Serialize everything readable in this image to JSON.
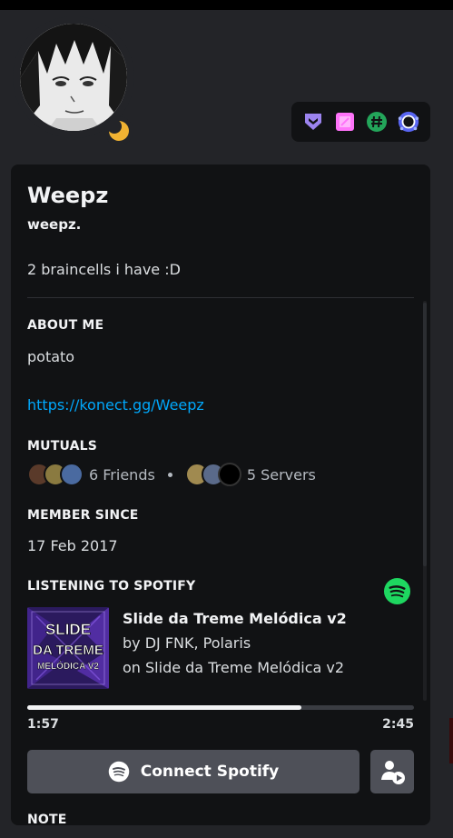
{
  "profile": {
    "display_name": "Weepz",
    "username": "weepz.",
    "custom_status": "2 braincells i have :D",
    "status": "idle"
  },
  "badges": [
    {
      "icon": "hypesquad-bravery-icon",
      "color": "#9c84ef"
    },
    {
      "icon": "nitro-boost-icon",
      "color": "#ff73fa"
    },
    {
      "icon": "hashtag-quest-icon",
      "color": "#23a55a"
    },
    {
      "icon": "early-supporter-icon",
      "color": "#5865f2"
    }
  ],
  "about": {
    "title": "ABOUT ME",
    "text": "potato",
    "link": "https://konect.gg/Weepz"
  },
  "mutuals": {
    "title": "MUTUALS",
    "friends_label": "6 Friends",
    "servers_label": "5 Servers"
  },
  "member_since": {
    "title": "MEMBER SINCE",
    "date": "17 Feb 2017"
  },
  "spotify": {
    "title": "LISTENING TO SPOTIFY",
    "track": "Slide da Treme Melódica v2",
    "artist": "by DJ FNK, Polaris",
    "album": "on Slide da Treme Melódica v2",
    "album_art_lines": [
      "SLIDE",
      "DA TREME",
      "MELÓDICA V2"
    ],
    "elapsed": "1:57",
    "duration": "2:45",
    "progress": 0.71,
    "connect_label": "Connect Spotify",
    "brand_color": "#1ed760"
  },
  "note": {
    "title": "NOTE"
  }
}
